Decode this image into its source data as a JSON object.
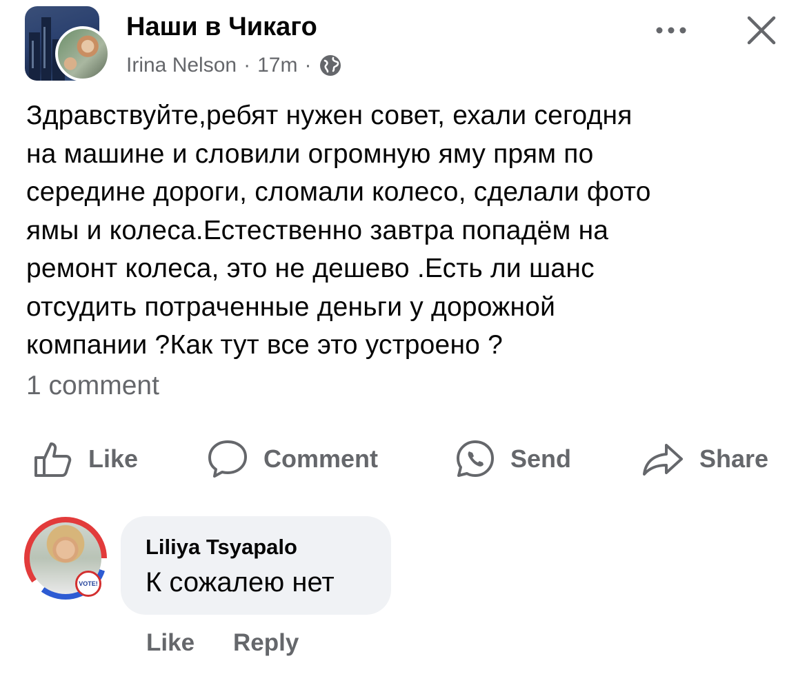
{
  "header": {
    "group_name": "Наши в Чикаго",
    "author": "Irina Nelson",
    "time": "17m",
    "separator": "·",
    "privacy_icon": "globe-icon",
    "more_icon": "more-icon",
    "close_icon": "close-icon"
  },
  "post": {
    "text": "Здравствуйте,ребят нужен совет, ехали сегодня\nна машине и словили огромную яму прям по\nсередине дороги, сломали колесо, сделали фото\nямы и колеса.Естественно завтра попадём на\nремонт колеса, это не дешево .Есть ли шанс\nотсудить потраченные деньги у дорожной\nкомпании ?Как тут все это устроено ?",
    "comment_count": "1 comment"
  },
  "actions": {
    "like": "Like",
    "comment": "Comment",
    "send": "Send",
    "share": "Share"
  },
  "comment": {
    "author": "Liliya Tsyapalo",
    "text": "К сожалею нет",
    "badge_text": "VOTE!",
    "like": "Like",
    "reply": "Reply"
  },
  "colors": {
    "secondary_text": "#65676b",
    "bubble": "#f0f2f5"
  }
}
